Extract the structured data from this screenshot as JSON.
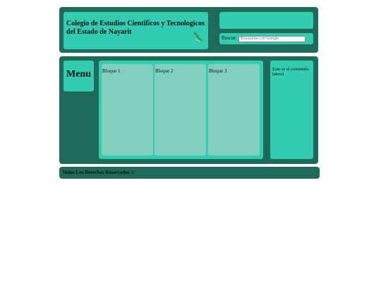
{
  "header": {
    "title": "Colegio de Estudios Cientificos y Tecnologicos del Estado de Nayarit",
    "logo_icon": "nayarit-map-logo-icon",
    "search": {
      "label": "Buscar:",
      "placeholder": "Busqueda con Google",
      "value": ""
    }
  },
  "content": {
    "menu_title": "Menu",
    "blocks": [
      {
        "label": "Bloque 1"
      },
      {
        "label": "Bloque 2"
      },
      {
        "label": "Bloque 3"
      }
    ],
    "sidebar_text": "Este es el contenido lateral"
  },
  "footer": {
    "text": "Todos Los Derechos Reservados ©"
  },
  "colors": {
    "dark": "#1e6b5a",
    "mint": "#33ccb0",
    "pale": "#80cfc0"
  }
}
